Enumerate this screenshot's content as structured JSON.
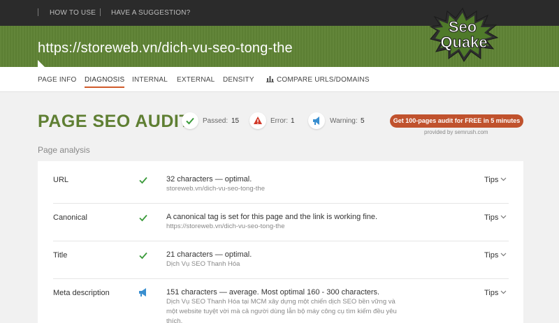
{
  "topbar": {
    "links": [
      "HOW TO USE",
      "HAVE A SUGGESTION?"
    ]
  },
  "header": {
    "url": "https://storeweb.vn/dich-vu-seo-tong-the",
    "logo_text": [
      "Seo",
      "Quake"
    ]
  },
  "nav": {
    "tabs": [
      "PAGE INFO",
      "DIAGNOSIS",
      "INTERNAL",
      "EXTERNAL",
      "DENSITY",
      "COMPARE URLS/DOMAINS"
    ],
    "active": "DIAGNOSIS"
  },
  "audit": {
    "title": "PAGE SEO AUDIT",
    "passed_label": "Passed:",
    "passed_count": "15",
    "error_label": "Error:",
    "error_count": "1",
    "warning_label": "Warning:",
    "warning_count": "5",
    "cta": "Get 100-pages audit for FREE in 5 minutes",
    "provided_by": "provided by  semrush.com"
  },
  "analysis": {
    "section_title": "Page analysis",
    "tips_label": "Tips",
    "rows": [
      {
        "name": "URL",
        "status": "passed",
        "main": "32 characters — optimal.",
        "sub": "storeweb.vn/dich-vu-seo-tong-the"
      },
      {
        "name": "Canonical",
        "status": "passed",
        "main": "A canonical tag is set for this page and the link is working fine.",
        "sub": "https://storeweb.vn/dich-vu-seo-tong-the"
      },
      {
        "name": "Title",
        "status": "passed",
        "main": "21 characters — optimal.",
        "sub": "Dịch Vụ SEO Thanh Hóa"
      },
      {
        "name": "Meta description",
        "status": "warning",
        "main": "151 characters — average. Most optimal 160 - 300 characters.",
        "sub": "Dịch Vụ SEO Thanh Hóa tại MCM xây dựng một chiến dịch SEO bền vững và một website tuyệt vời mà cả người dùng lẫn bộ máy công cụ tìm kiếm đều yêu thích."
      }
    ]
  },
  "colors": {
    "header_green": "#5f8335",
    "title_green": "#5f7f33",
    "cta_orange": "#c0522d",
    "passed_green": "#3a9a3a",
    "error_red": "#d23a2a",
    "warning_blue": "#3a8fd0"
  }
}
